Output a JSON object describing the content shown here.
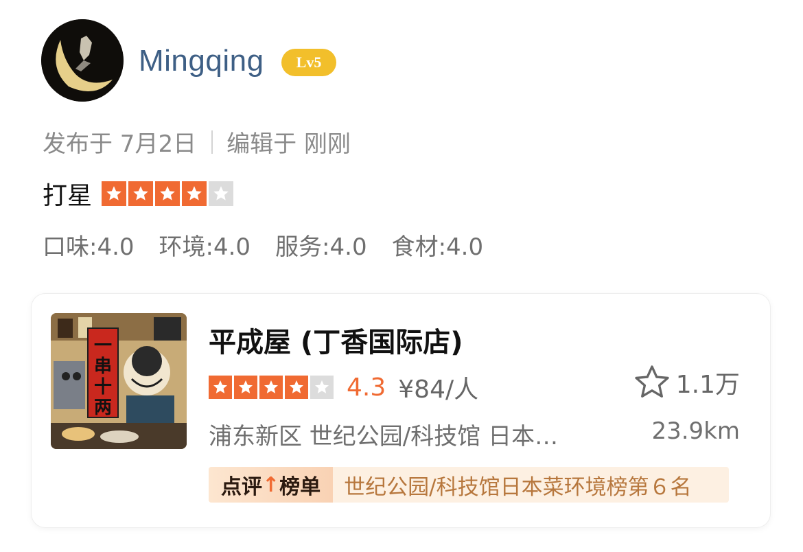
{
  "user": {
    "name": "Mingqing",
    "level": "Lv5",
    "avatar_icon": "avatar-moon-icon"
  },
  "post": {
    "published": "发布于 7月2日",
    "edited": "编辑于 刚刚"
  },
  "rating": {
    "label": "打星",
    "stars": 4,
    "max": 5,
    "subscores": [
      "口味:4.0",
      "环境:4.0",
      "服务:4.0",
      "食材:4.0"
    ]
  },
  "shop": {
    "name": "平成屋 (丁香国际店)",
    "stars": 4,
    "score": "4.3",
    "price": "¥84/人",
    "favorites": "1.1万",
    "location": "浦东新区 世纪公园/科技馆 日本…",
    "distance": "23.9km",
    "rank_tag": "点评榜单",
    "rank_tag_a": "点评",
    "rank_tag_b": "榜单",
    "rank_text": "世纪公园/科技馆日本菜环境榜第６名",
    "image_text": "一串十两"
  },
  "colors": {
    "accent": "#f06a32",
    "username": "#3e5f85",
    "badge": "#f2bf2b"
  }
}
